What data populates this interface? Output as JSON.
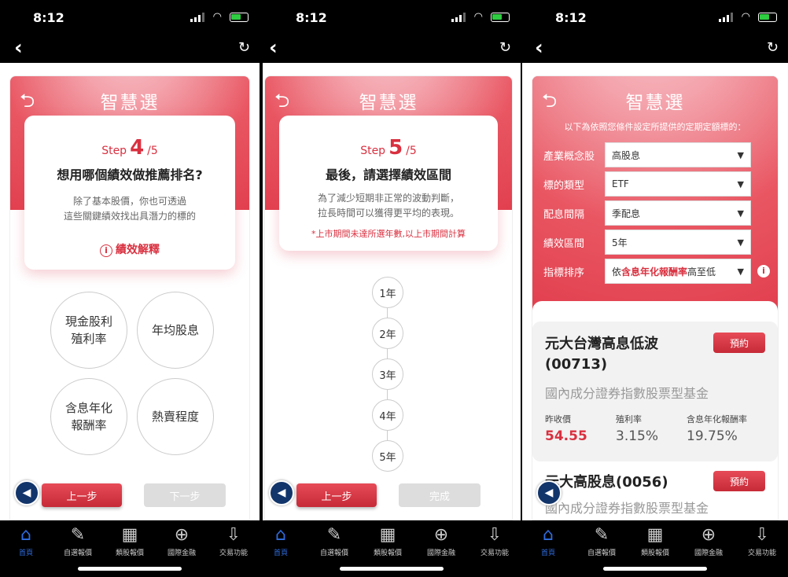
{
  "status": {
    "time": "8:12"
  },
  "page_title": "智慧選",
  "tabbar": [
    {
      "label": "首頁",
      "icon": "home-icon"
    },
    {
      "label": "自選報價",
      "icon": "watchlist-icon"
    },
    {
      "label": "類股報價",
      "icon": "sector-icon"
    },
    {
      "label": "國際金融",
      "icon": "globe-icon"
    },
    {
      "label": "交易功能",
      "icon": "trade-icon"
    }
  ],
  "screen1": {
    "step_prefix": "Step",
    "step_num": "4",
    "step_total": "/5",
    "question": "想用哪個績效做推薦排名?",
    "desc1": "除了基本股價，你也可透過",
    "desc2": "這些關鍵績效找出具潛力的標的",
    "explain": "績效解釋",
    "options": [
      "現金股利殖利率",
      "年均股息",
      "含息年化報酬率",
      "熱賣程度"
    ],
    "prev": "上一步",
    "next": "下一步"
  },
  "screen2": {
    "step_prefix": "Step",
    "step_num": "5",
    "step_total": "/5",
    "question": "最後，請選擇績效區間",
    "desc1": "為了減少短期非正常的波動判斷，",
    "desc2": "拉長時間可以獲得更平均的表現。",
    "warning": "*上市期間未達所選年數,以上市期間計算",
    "years": [
      "1年",
      "2年",
      "3年",
      "4年",
      "5年"
    ],
    "prev": "上一步",
    "done": "完成"
  },
  "screen3": {
    "intro": "以下為依照您條件設定所提供的定期定額標的：",
    "filters": [
      {
        "label": "產業概念股",
        "value": "高股息"
      },
      {
        "label": "標的類型",
        "value": "ETF"
      },
      {
        "label": "配息間隔",
        "value": "季配息"
      },
      {
        "label": "績效區間",
        "value": "5年"
      }
    ],
    "sort_label": "指標排序",
    "sort_pre": "依",
    "sort_key": "含息年化報酬率",
    "sort_post": "高至低",
    "funds": [
      {
        "name": "元大台灣高息低波",
        "code": "(00713)",
        "type": "國內成分證券指數股票型基金",
        "book": "預約",
        "m1_label": "昨收價",
        "m1_value": "54.55",
        "m2_label": "殖利率",
        "m2_value": "3.15%",
        "m3_label": "含息年化報酬率",
        "m3_value": "19.75%"
      },
      {
        "name": "元大高股息(0056)",
        "type": "國內成分證券指數股票型基金",
        "book": "預約"
      }
    ]
  }
}
